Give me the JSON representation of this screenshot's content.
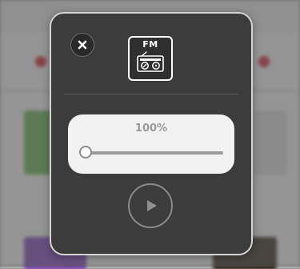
{
  "player": {
    "close_icon": "close-icon",
    "station_logo": {
      "text": "FM",
      "icon": "radio-icon"
    },
    "volume": {
      "label": "100%",
      "slider_fraction": 0
    },
    "play_icon": "play-icon"
  },
  "colors": {
    "modal_bg": "#3c3c3c",
    "modal_border": "#d4d4d4",
    "panel_bg": "#f2f2f2",
    "label_text": "#9a9a9a",
    "slider_track": "#9b9b9b",
    "play_ring": "#8a8a8a"
  }
}
